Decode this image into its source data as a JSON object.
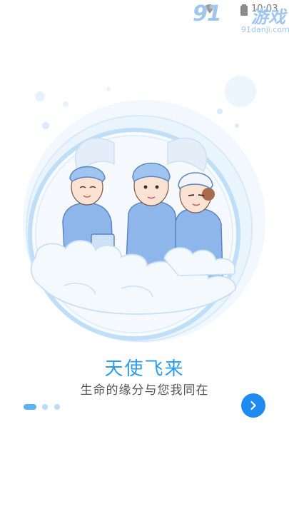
{
  "status_bar": {
    "time": "10:03"
  },
  "watermark": {
    "logo": "91",
    "text": "游戏",
    "url": "91danji.com"
  },
  "onboarding": {
    "title": "天使飞来",
    "subtitle": "生命的缘分与您我同在",
    "page_count": 3,
    "active_page": 1
  },
  "colors": {
    "accent": "#2d9cf0",
    "button": "#1e8bf0",
    "dot_inactive": "#b8dcf6"
  },
  "icons": {
    "next": "chevron-right-icon"
  }
}
